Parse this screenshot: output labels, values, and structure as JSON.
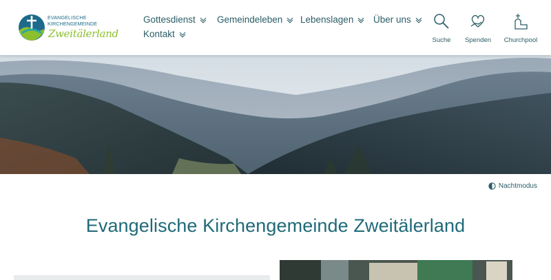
{
  "logo": {
    "line1": "EVANGELISCHE",
    "line2": "KIRCHENGEMEINDE",
    "script": "Zweitälerland",
    "colors": {
      "blue": "#1e6a8a",
      "green": "#8cbf2e",
      "teal": "#2aa6a0"
    }
  },
  "nav": {
    "items": [
      {
        "label": "Gottesdienst",
        "has_dropdown": true
      },
      {
        "label": "Gemeindeleben",
        "has_dropdown": true
      },
      {
        "label": "Lebenslagen",
        "has_dropdown": true
      },
      {
        "label": "Über uns",
        "has_dropdown": true
      },
      {
        "label": "Kontakt",
        "has_dropdown": true
      }
    ]
  },
  "quicklinks": [
    {
      "label": "Suche",
      "icon": "search-icon"
    },
    {
      "label": "Spenden",
      "icon": "donate-icon"
    },
    {
      "label": "Churchpool",
      "icon": "churchpool-icon"
    }
  ],
  "hero": {
    "description_icon": "mountain-valley-photo"
  },
  "night_mode": {
    "label": "Nachtmodus",
    "icon": "contrast-icon"
  },
  "page": {
    "title": "Evangelische Kirchengemeinde Zweitälerland"
  },
  "theme": {
    "text": "#2b5d67",
    "title": "#1f6a78"
  }
}
